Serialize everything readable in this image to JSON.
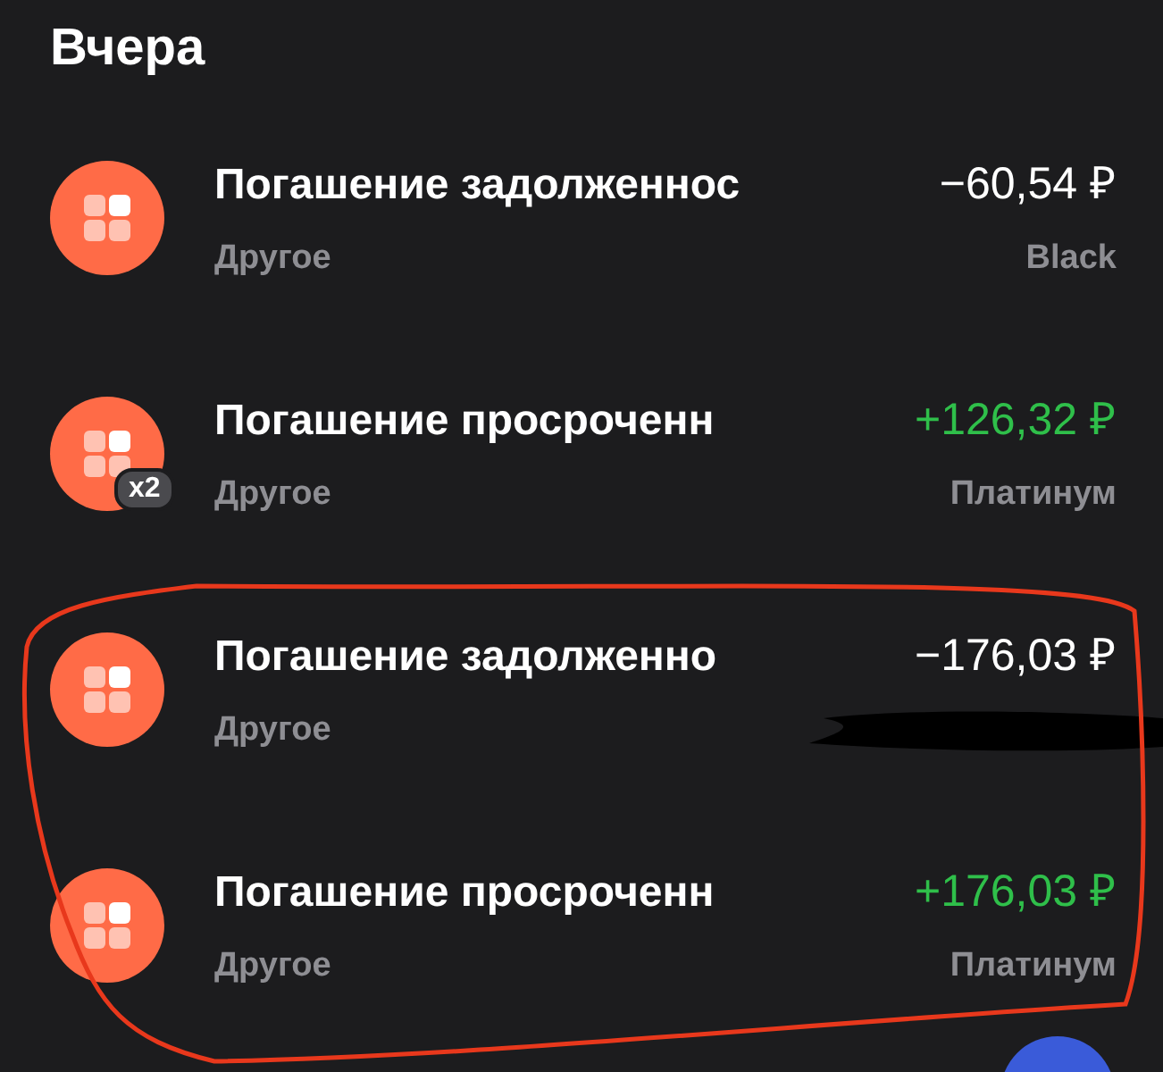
{
  "section_title": "Вчера",
  "transactions": [
    {
      "title": "Погашение задолженнос",
      "category": "Другое",
      "amount": "−60,54 ₽",
      "kind": "debit",
      "account": "Black"
    },
    {
      "title": "Погашение просроченн",
      "category": "Другое",
      "amount": "+126,32 ₽",
      "kind": "credit",
      "account": "Платинум",
      "badge": "x2"
    },
    {
      "title": "Погашение задолженно",
      "category": "Другое",
      "amount": "−176,03 ₽",
      "kind": "debit",
      "redacted": true
    },
    {
      "title": "Погашение просроченн",
      "category": "Другое",
      "amount": "+176,03 ₽",
      "kind": "credit",
      "account": "Платинум"
    }
  ]
}
